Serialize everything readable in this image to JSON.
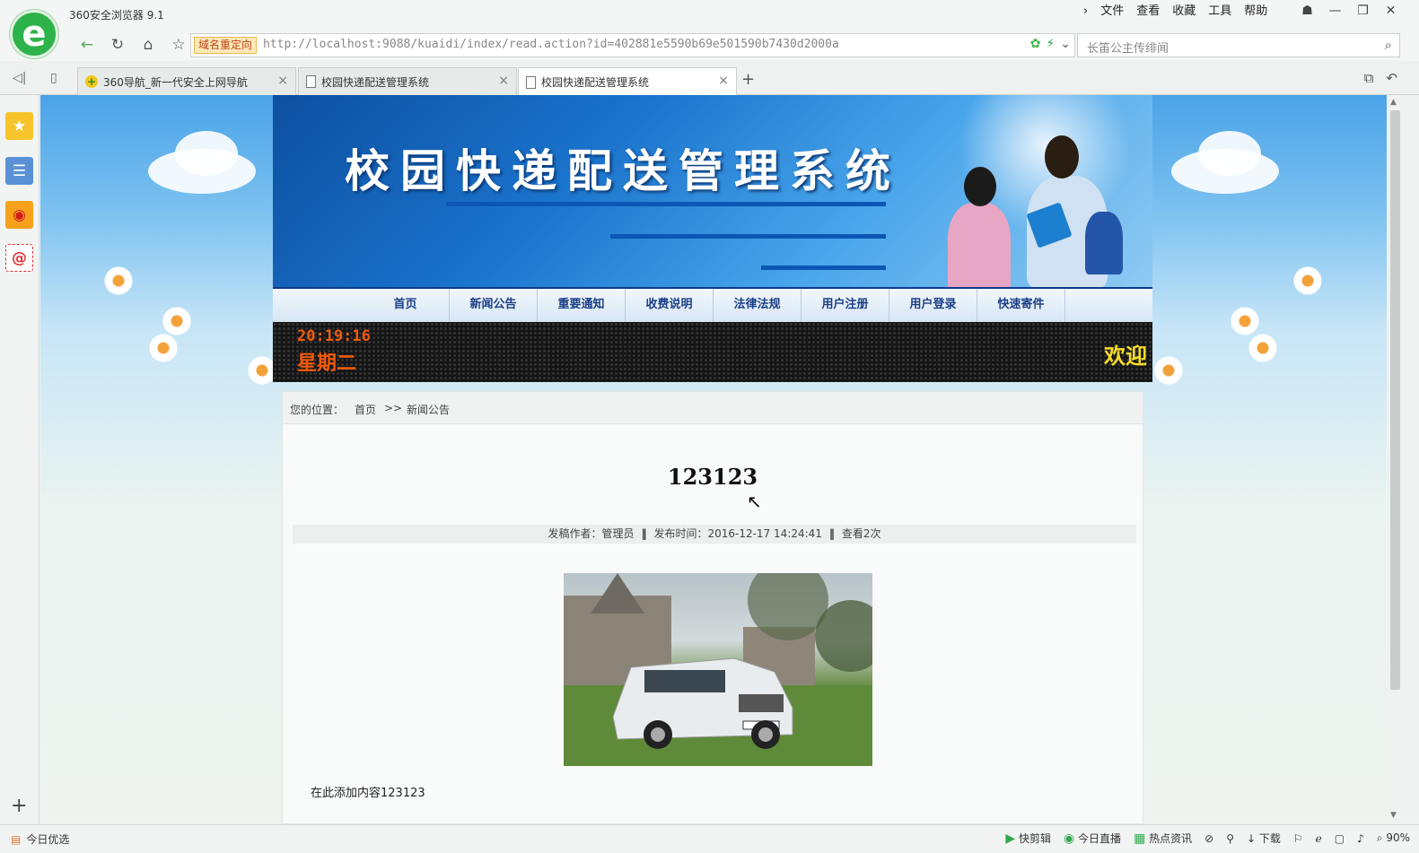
{
  "browser": {
    "app_name": "360安全浏览器 9.1",
    "menu": [
      "文件",
      "查看",
      "收藏",
      "工具",
      "帮助"
    ],
    "window_controls": [
      "shirt-icon",
      "minimize-icon",
      "restore-icon",
      "close-icon"
    ],
    "address": {
      "redirect_badge": "域名重定向",
      "url": "http://localhost:9088/kuaidi/index/read.action?id=402881e5590b69e501590b7430d2000a"
    },
    "search": {
      "placeholder": "长笛公主传绯闻"
    },
    "tabs": [
      {
        "label": "360导航_新一代安全上网导航",
        "active": false,
        "icon": "360-icon"
      },
      {
        "label": "校园快递配送管理系统",
        "active": false,
        "icon": "document-icon"
      },
      {
        "label": "校园快递配送管理系统",
        "active": true,
        "icon": "document-icon"
      }
    ],
    "status_left": "今日优选",
    "status_right": [
      "快剪辑",
      "今日直播",
      "热点资讯",
      "下载",
      "90%"
    ]
  },
  "site": {
    "banner_title": "校园快递配送管理系统",
    "nav": [
      "首页",
      "新闻公告",
      "重要通知",
      "收费说明",
      "法律法规",
      "用户注册",
      "用户登录",
      "快速寄件"
    ],
    "clock": {
      "time": "20:19:16",
      "weekday": "星期二"
    },
    "marquee": "欢迎",
    "breadcrumb": {
      "prefix": "您的位置：",
      "home": "首页",
      "separator": ">>",
      "current": "新闻公告"
    },
    "article": {
      "title": "123123",
      "author_label": "发稿作者：管理员",
      "time_label": "发布时间：2016-12-17 14:24:41",
      "views_label": "查看2次",
      "body": "在此添加内容123123"
    }
  },
  "colors": {
    "accent": "#0b3c8c",
    "led_orange": "#f05a0a",
    "led_yellow": "#f6dd27"
  }
}
